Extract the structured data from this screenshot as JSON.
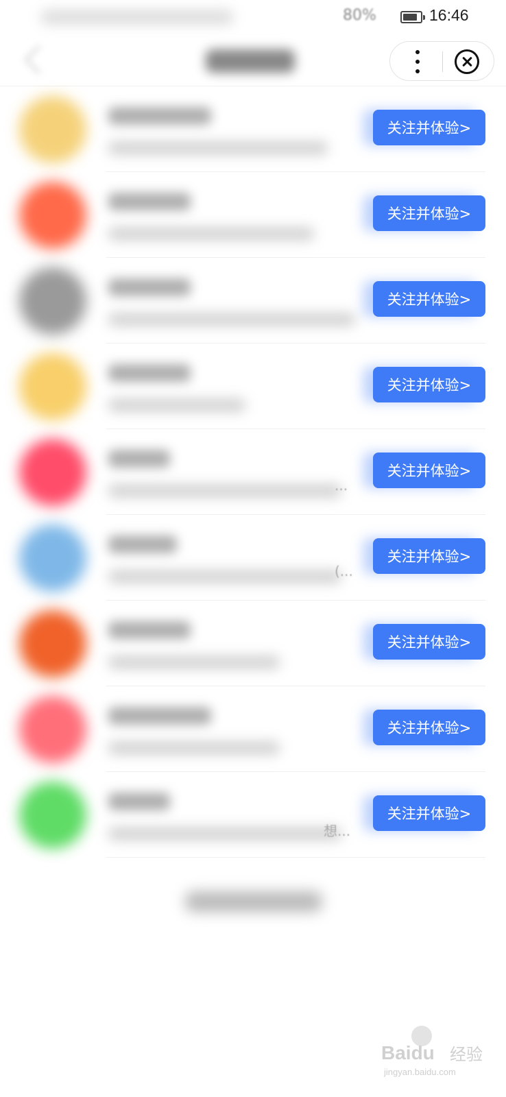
{
  "status_bar": {
    "battery_text": "80%",
    "time": "16:46"
  },
  "nav": {
    "more_icon": "more-vertical-icon",
    "close_icon": "close-circle-icon"
  },
  "list": {
    "button_color": "#3f7bf6",
    "items": [
      {
        "follow_label": "关注并体验>",
        "avatar_color": "#f5d27a",
        "ellipsis": ""
      },
      {
        "follow_label": "关注并体验>",
        "avatar_color": "#ff6a4a",
        "ellipsis": ""
      },
      {
        "follow_label": "关注并体验>",
        "avatar_color": "#9a9a9a",
        "ellipsis": ""
      },
      {
        "follow_label": "关注并体验>",
        "avatar_color": "#f8cf6a",
        "ellipsis": ""
      },
      {
        "follow_label": "关注并体验>",
        "avatar_color": "#ff4d6a",
        "ellipsis": "..."
      },
      {
        "follow_label": "关注并体验>",
        "avatar_color": "#7fb8e8",
        "ellipsis": "(..."
      },
      {
        "follow_label": "关注并体验>",
        "avatar_color": "#f0622a",
        "ellipsis": ""
      },
      {
        "follow_label": "关注并体验>",
        "avatar_color": "#ff6f7a",
        "ellipsis": ""
      },
      {
        "follow_label": "关注并体验>",
        "avatar_color": "#5fdc66",
        "ellipsis": "想..."
      }
    ]
  },
  "watermark": {
    "logo": "Baidu",
    "cn": "经验",
    "url": "jingyan.baidu.com"
  }
}
